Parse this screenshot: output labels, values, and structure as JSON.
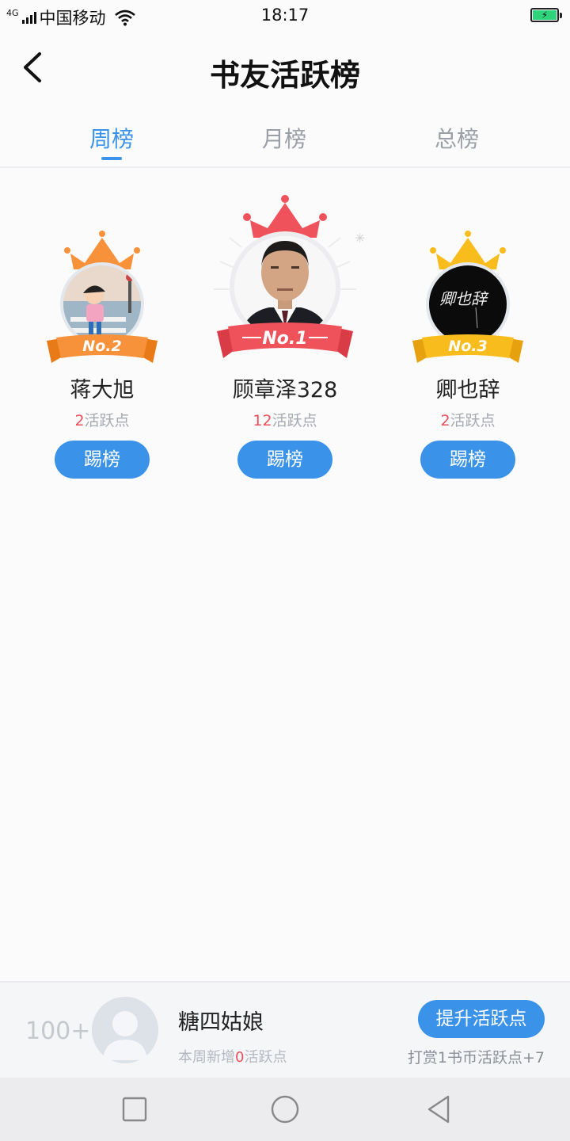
{
  "status_bar": {
    "network": "4G",
    "carrier": "中国移动",
    "time": "18:17"
  },
  "header": {
    "title": "书友活跃榜"
  },
  "tabs": [
    {
      "label": "周榜",
      "active": true
    },
    {
      "label": "月榜",
      "active": false
    },
    {
      "label": "总榜",
      "active": false
    }
  ],
  "podium": {
    "first": {
      "rank": "No.1",
      "name": "顾章泽328",
      "points": "12",
      "points_suffix": "活跃点",
      "button": "踢榜"
    },
    "second": {
      "rank": "No.2",
      "name": "蒋大旭",
      "points": "2",
      "points_suffix": "活跃点",
      "button": "踢榜"
    },
    "third": {
      "rank": "No.3",
      "name": "卿也辞",
      "points": "2",
      "points_suffix": "活跃点",
      "button": "踢榜",
      "avatar_text": "卿也辞"
    }
  },
  "my_rank": {
    "rank": "100+",
    "name": "糖四姑娘",
    "sub_prefix": "本周新增",
    "sub_points": "0",
    "sub_suffix": "活跃点",
    "boost_button": "提升活跃点",
    "reward_text": "打赏1书币活跃点+7"
  },
  "colors": {
    "accent": "#3b93e9",
    "points_red": "#e8505a",
    "crown_first": "#f0525b",
    "crown_second": "#f7913a",
    "crown_third": "#f8bd1c"
  },
  "icons": {
    "back": "chevron-left-icon",
    "nav_square": "square-icon",
    "nav_home": "circle-icon",
    "nav_back": "triangle-back-icon"
  }
}
